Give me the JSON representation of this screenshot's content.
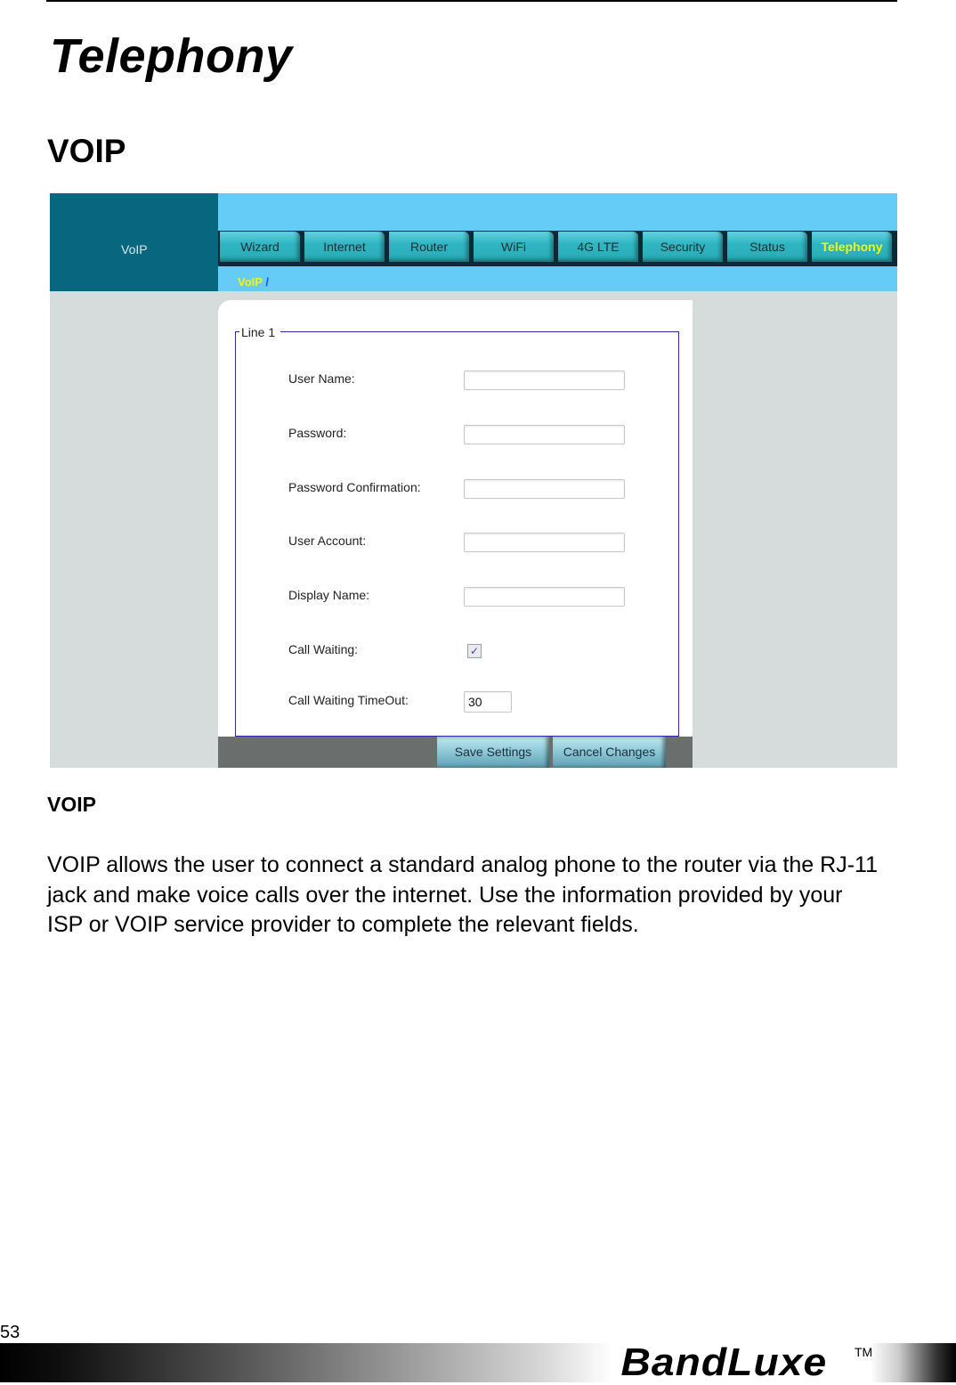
{
  "document": {
    "title": "Telephony",
    "section_title": "VOIP",
    "caption_title": "VOIP",
    "body": "VOIP allows the user to connect a standard analog phone to the router via the RJ-11 jack and make voice calls over the internet. Use the information provided by your ISP or VOIP service provider to complete the relevant fields.",
    "page_number": "53",
    "brand": "BandLuxe",
    "trademark": "TM"
  },
  "screenshot": {
    "page_label": "VoIP",
    "tabs": [
      {
        "label": "Wizard",
        "active": false
      },
      {
        "label": "Internet",
        "active": false
      },
      {
        "label": "Router",
        "active": false
      },
      {
        "label": "WiFi",
        "active": false
      },
      {
        "label": "4G LTE",
        "active": false
      },
      {
        "label": "Security",
        "active": false
      },
      {
        "label": "Status",
        "active": false
      },
      {
        "label": "Telephony",
        "active": true
      }
    ],
    "breadcrumb": {
      "current": "VoIP",
      "separator": "/"
    },
    "fieldset_legend": "Line 1",
    "fields": [
      {
        "label": "User Name:",
        "value": ""
      },
      {
        "label": "Password:",
        "value": ""
      },
      {
        "label": "Password Confirmation:",
        "value": ""
      },
      {
        "label": "User Account:",
        "value": ""
      },
      {
        "label": "Display Name:",
        "value": ""
      },
      {
        "label": "Call Waiting:",
        "checked": true
      },
      {
        "label": "Call Waiting TimeOut:",
        "value": "30"
      }
    ],
    "buttons": {
      "save": "Save Settings",
      "cancel": "Cancel Changes"
    },
    "colors": {
      "header_dark": "#07677f",
      "header_light": "#65ccf8",
      "active_tab_text": "#f6f70e",
      "fieldset_border": "#2a2d9a"
    }
  }
}
